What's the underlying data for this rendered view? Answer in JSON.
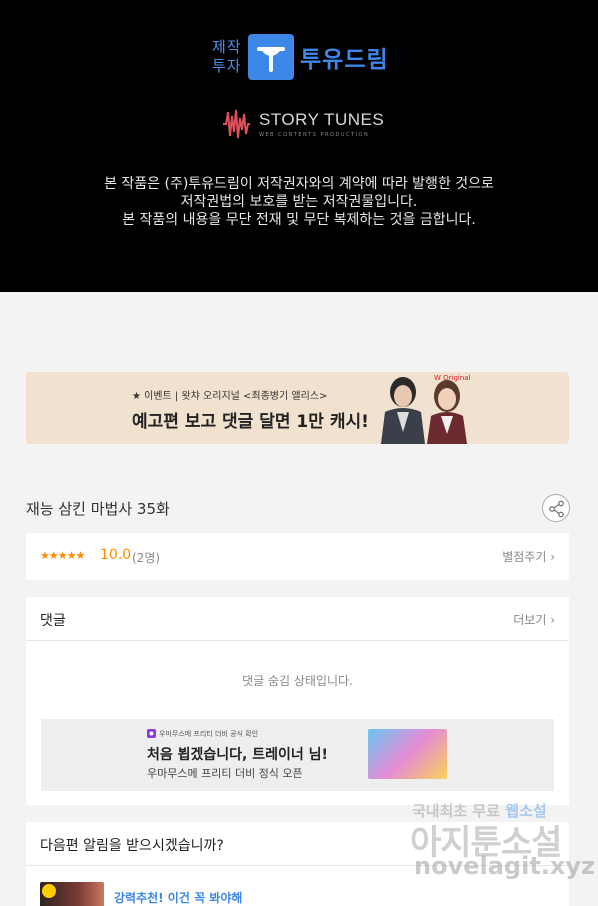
{
  "hero": {
    "publisher_small_1": "제작",
    "publisher_small_2": "투자",
    "publisher_brand": "투유드림",
    "studio_name": "STORY TUNES",
    "studio_sub": "WEB CONTENTS PRODUCTION",
    "notice_line1": "본 작품은 (주)투유드림이 저작권자와의 계약에 따라 발행한 것으로",
    "notice_line2": "저작권법의 보호를 받는 저작권물입니다.",
    "notice_line3": "본 작품의 내용을 무단 전재 및 무단 복제하는 것을 금합니다.",
    "brand_color": "#3d87e8"
  },
  "banner": {
    "small": "★ 이벤트 | 왓챠 오리지널 <최종병기 앨리스>",
    "big": "예고편 보고 댓글 달면 1만 캐시!",
    "tag": "W Original"
  },
  "episode": {
    "title": "재능 삼킨 마법사 35화"
  },
  "rating": {
    "stars": "★★★★★",
    "score": "10.0",
    "count": "(2명)",
    "rate_link": "별점주기 ›"
  },
  "comments": {
    "title": "댓글",
    "more": "더보기 ›",
    "hidden_message": "댓글 숨김 상태입니다."
  },
  "ad": {
    "tiny": "우마무스메 프리티 더비 공식 확인",
    "headline": "처음 뵙겠습니다, 트레이너 님!",
    "sub": "우마무스메 프리티 더비 정식 오픈"
  },
  "notify": {
    "title": "다음편 알림을 받으시겠습니까?",
    "recommend": "강력추천! 이건 꼭 봐야해"
  },
  "watermark": {
    "line1_a": "국내최초 무료",
    "line1_b": "웹소설",
    "line2": "아지툰소설",
    "line3": "novelagit.xyz"
  }
}
